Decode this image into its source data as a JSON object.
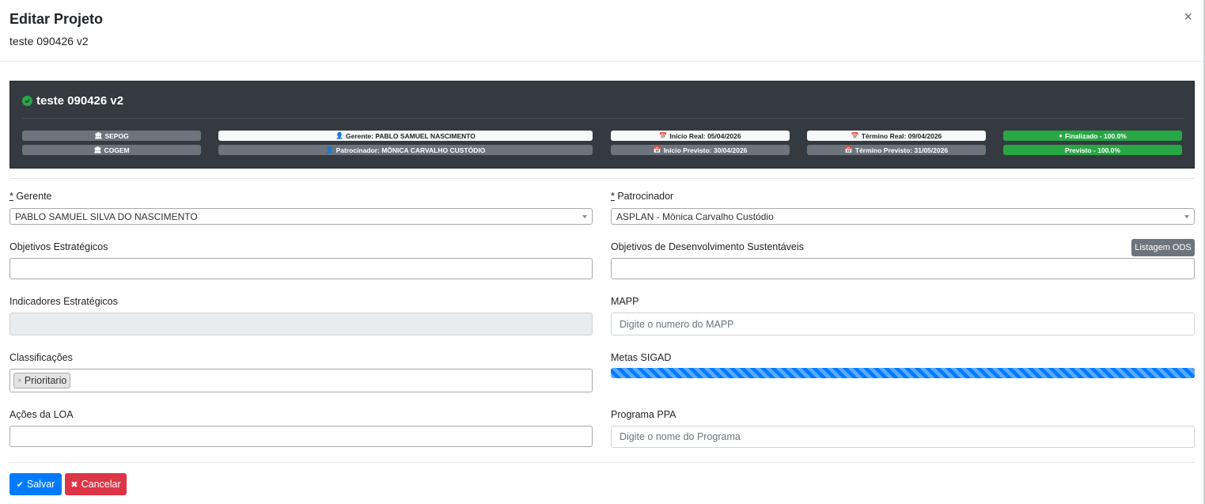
{
  "modal": {
    "title": "Editar Projeto",
    "subtitle": "teste 090426 v2",
    "close_label": "×"
  },
  "project_card": {
    "name": "teste 090426 v2",
    "badges": {
      "org1": "SEPOG",
      "org2": "COGEM",
      "gerente": "Gerente: PABLO SAMUEL NASCIMENTO",
      "patrocinador": "Patrocinador: MÔNICA CARVALHO CUSTÓDIO",
      "inicio_real": "Início Real: 05/04/2026",
      "inicio_previsto": "Início Previsto: 30/04/2026",
      "termino_real": "Término Real: 09/04/2026",
      "termino_previsto": "Término Previsto: 31/05/2026",
      "status": "Finalizado - 100.0%",
      "previsto": "Previsto - 100.0%"
    },
    "colors": {
      "success": "#28a745",
      "dark": "#343a40",
      "secondary": "#6c757d",
      "light": "#f8f9fa"
    }
  },
  "form": {
    "gerente": {
      "required_mark": "*",
      "label": " Gerente",
      "value": "PABLO SAMUEL SILVA DO NASCIMENTO"
    },
    "patrocinador": {
      "required_mark": "*",
      "label": " Patrocinador",
      "value": "ASPLAN - Mônica Carvalho Custódio"
    },
    "objetivos_estrategicos": {
      "label": "Objetivos Estratégicos"
    },
    "ods": {
      "label": "Objetivos de Desenvolvimento Sustentáveis",
      "button": "Listagem ODS"
    },
    "indicadores": {
      "label": "Indicadores Estratégicos"
    },
    "mapp": {
      "label": "MAPP",
      "placeholder": "Digite o numero do MAPP"
    },
    "classificacoes": {
      "label": "Classificações",
      "tags": [
        "Prioritario"
      ]
    },
    "metas_sigad": {
      "label": "Metas SIGAD",
      "progress": 1.0,
      "color": "#007bff"
    },
    "acoes_loa": {
      "label": "Ações da LOA"
    },
    "programa_ppa": {
      "label": "Programa PPA",
      "placeholder": "Digite o nome do Programa"
    }
  },
  "footer": {
    "save_label": "Salvar",
    "cancel_label": "Cancelar",
    "save_color": "#007bff",
    "cancel_color": "#dc3545"
  }
}
